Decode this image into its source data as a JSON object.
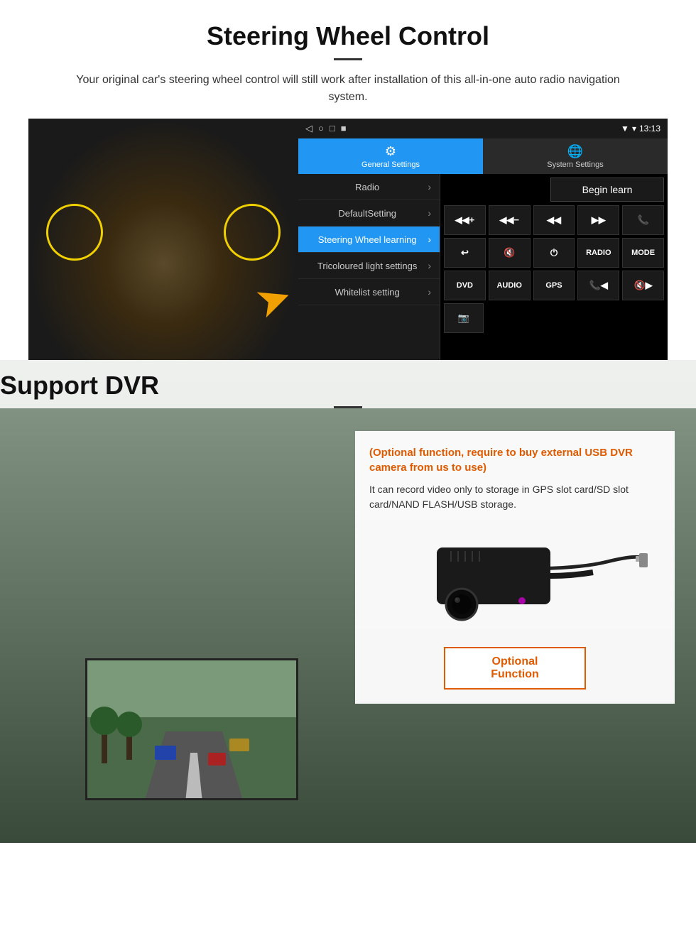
{
  "steering": {
    "title": "Steering Wheel Control",
    "description": "Your original car's steering wheel control will still work after installation of this all-in-one auto radio navigation system.",
    "statusbar": {
      "left_icons": [
        "◁",
        "○",
        "□",
        "■"
      ],
      "right_time": "13:13",
      "right_icons": [
        "▼"
      ]
    },
    "tabs": {
      "general": {
        "label": "General Settings",
        "icon": "⚙"
      },
      "system": {
        "label": "System Settings",
        "icon": "🌐"
      }
    },
    "menu_items": [
      {
        "label": "Radio",
        "active": false
      },
      {
        "label": "DefaultSetting",
        "active": false
      },
      {
        "label": "Steering Wheel learning",
        "active": true
      },
      {
        "label": "Tricoloured light settings",
        "active": false
      },
      {
        "label": "Whitelist setting",
        "active": false
      }
    ],
    "begin_learn_label": "Begin learn",
    "control_buttons_row1": [
      "◀◀+",
      "◀◀−",
      "◀◀",
      "▶▶",
      "📞"
    ],
    "control_buttons_row2": [
      "↩",
      "🔇",
      "⏻",
      "RADIO",
      "MODE"
    ],
    "control_buttons_row3": [
      "DVD",
      "AUDIO",
      "GPS",
      "📞◀◀",
      "🔇▶▶"
    ],
    "control_buttons_row4": [
      "📷"
    ]
  },
  "dvr": {
    "title": "Support DVR",
    "optional_text": "(Optional function, require to buy external USB DVR camera from us to use)",
    "description": "It can record video only to storage in GPS slot card/SD slot card/NAND FLASH/USB storage.",
    "optional_function_label": "Optional Function"
  }
}
